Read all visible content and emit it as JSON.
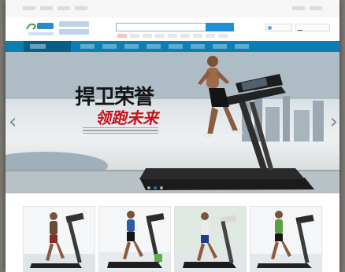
{
  "topbar": {
    "left_links": [
      "",
      "",
      "",
      ""
    ],
    "right_links": [
      "",
      ""
    ]
  },
  "header": {
    "store_name": "",
    "search": {
      "placeholder": "",
      "hot_label": "",
      "hot_keywords": [
        "",
        "",
        "",
        "",
        "",
        "",
        "",
        ""
      ]
    },
    "member_label": "",
    "cart_label": ""
  },
  "nav": {
    "all_categories_label": "",
    "items": [
      "",
      "",
      "",
      "",
      "",
      "",
      "",
      ""
    ]
  },
  "hero": {
    "title": "捍卫荣誉",
    "subtitle": "领跑未来",
    "caption": "",
    "slide_count": 3,
    "active_slide": 1
  },
  "products": [
    {
      "name": ""
    },
    {
      "name": ""
    },
    {
      "name": ""
    },
    {
      "name": ""
    }
  ],
  "colors": {
    "accent": "#0b7fb0",
    "accent_dark": "#075f88",
    "headline": "#151515",
    "headline_red": "#c8121a"
  }
}
